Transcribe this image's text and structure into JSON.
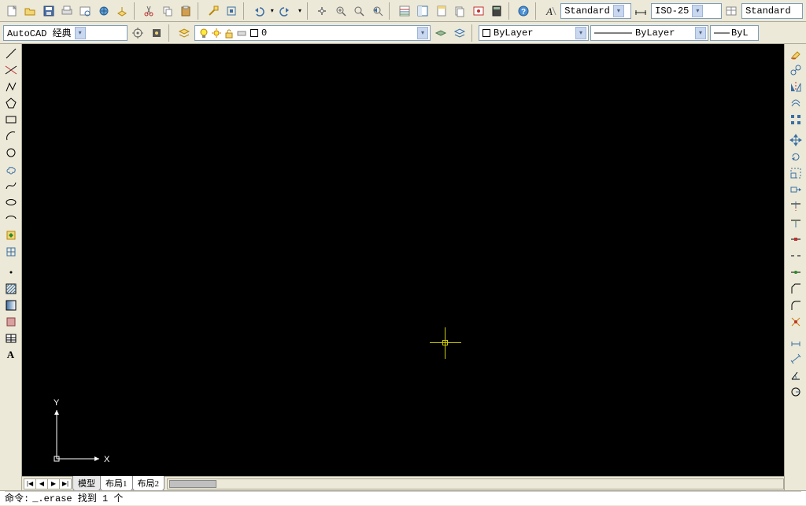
{
  "toolbar1": {
    "new_file": "new",
    "open": "open",
    "save": "save",
    "print": "print",
    "help": "?"
  },
  "toolbar_styles": {
    "textstyle": "Standard",
    "dimstyle": "ISO-25",
    "tablestyle": "Standard"
  },
  "workspace": {
    "label": "AutoCAD 经典"
  },
  "layer": {
    "current": "0"
  },
  "properties": {
    "color_label": "ByLayer",
    "linetype_label": "ByLayer",
    "lineweight_label": "ByL"
  },
  "tabs": {
    "nav": [
      "|◀",
      "◀",
      "▶",
      "▶|"
    ],
    "items": [
      "模型",
      "布局1",
      "布局2"
    ],
    "active": 0
  },
  "ucs": {
    "x": "X",
    "y": "Y"
  },
  "command": {
    "prompt": "命令:",
    "text": "_.erase 找到 1 个"
  }
}
